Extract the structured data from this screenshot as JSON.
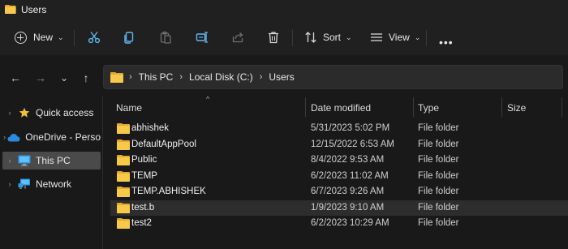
{
  "window": {
    "title": "Users",
    "folder_icon": "folder-icon"
  },
  "toolbar": {
    "new_label": "New",
    "sort_label": "Sort",
    "view_label": "View",
    "more_label": "•••",
    "icons": [
      "cut-icon",
      "copy-icon",
      "paste-icon",
      "rename-icon",
      "share-icon",
      "delete-icon"
    ]
  },
  "nav": {
    "back": "←",
    "forward": "→",
    "recent": "⌄",
    "up": "↑"
  },
  "address": {
    "crumbs": [
      "This PC",
      "Local Disk (C:)",
      "Users"
    ],
    "separator": "›"
  },
  "sidebar": {
    "items": [
      {
        "label": "Quick access",
        "icon": "star-icon",
        "selected": false
      },
      {
        "label": "OneDrive - Perso",
        "icon": "cloud-icon",
        "selected": false
      },
      {
        "label": "This PC",
        "icon": "monitor-icon",
        "selected": true
      },
      {
        "label": "Network",
        "icon": "network-icon",
        "selected": false
      }
    ]
  },
  "columns": {
    "name": "Name",
    "date": "Date modified",
    "type": "Type",
    "size": "Size"
  },
  "files": [
    {
      "name": "abhishek",
      "date": "5/31/2023 5:02 PM",
      "type": "File folder"
    },
    {
      "name": "DefaultAppPool",
      "date": "12/15/2022 6:53 AM",
      "type": "File folder"
    },
    {
      "name": "Public",
      "date": "8/4/2022 9:53 AM",
      "type": "File folder"
    },
    {
      "name": "TEMP",
      "date": "6/2/2023 11:02 AM",
      "type": "File folder"
    },
    {
      "name": "TEMP.ABHISHEK",
      "date": "6/7/2023 9:26 AM",
      "type": "File folder"
    },
    {
      "name": "test.b",
      "date": "1/9/2023 9:10 AM",
      "type": "File folder"
    },
    {
      "name": "test2",
      "date": "6/2/2023 10:29 AM",
      "type": "File folder"
    }
  ],
  "colors": {
    "folder": "#f6c94b",
    "accent": "#4cc2ff",
    "background": "#191919"
  }
}
